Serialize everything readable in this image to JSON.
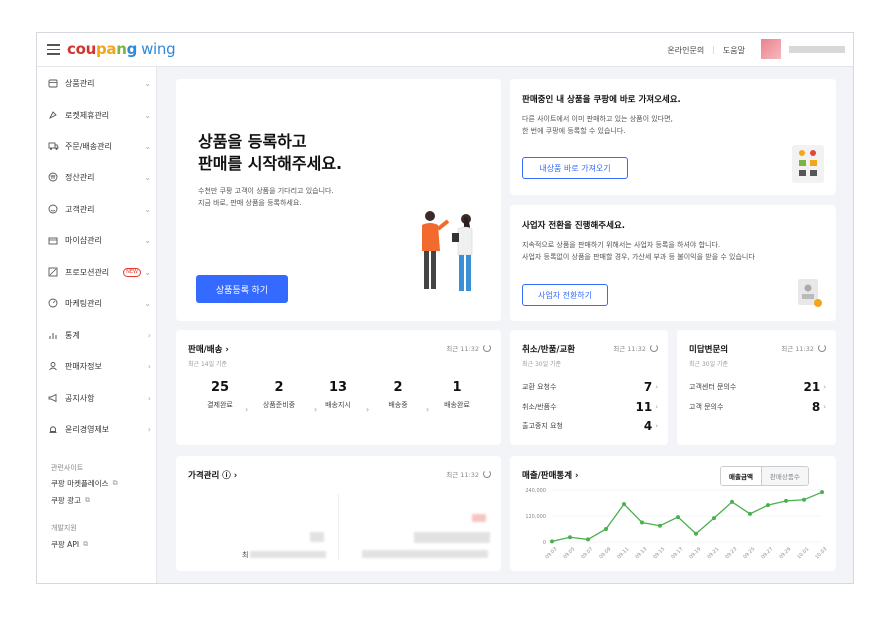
{
  "header": {
    "logo_parts": [
      "cou",
      "pa",
      "n",
      "g"
    ],
    "logo_wing": "wing",
    "links": [
      "온라인문의",
      "도움말"
    ]
  },
  "sidebar": {
    "items": [
      {
        "label": "상품관리",
        "icon": "box-icon"
      },
      {
        "label": "로켓제휴관리",
        "icon": "rocket-icon"
      },
      {
        "label": "주문/배송관리",
        "icon": "truck-icon"
      },
      {
        "label": "정산관리",
        "icon": "won-icon"
      },
      {
        "label": "고객관리",
        "icon": "smile-icon"
      },
      {
        "label": "마이샵관리",
        "icon": "shop-icon"
      },
      {
        "label": "프로모션관리",
        "icon": "promotion-icon",
        "badge": "NEW"
      },
      {
        "label": "마케팅관리",
        "icon": "marketing-icon"
      },
      {
        "label": "통계",
        "icon": "chart-icon"
      },
      {
        "label": "판매자정보",
        "icon": "user-icon"
      },
      {
        "label": "공지사항",
        "icon": "megaphone-icon"
      },
      {
        "label": "윤리경영제보",
        "icon": "bell-icon"
      }
    ],
    "related_title": "관련사이트",
    "related_links": [
      "쿠팡 마켓플레이스",
      "쿠팡 광고"
    ],
    "dev_title": "개발지원",
    "dev_links": [
      "쿠팡 API"
    ]
  },
  "hero": {
    "title_line1": "상품을 등록하고",
    "title_line2": "판매를 시작해주세요.",
    "sub_line1": "수천만 쿠팡 고객이 상품을 기다리고 있습니다.",
    "sub_line2": "지금 바로, 판매 상품을 등록하세요.",
    "button": "상품등록 하기"
  },
  "import_card": {
    "title": "판매중인 내 상품을 쿠팡에 바로 가져오세요.",
    "desc_line1": "다른 사이트에서 이미 판매하고 있는 상품이 있다면,",
    "desc_line2": "한 번에 쿠팡에 등록할 수 있습니다.",
    "button": "내상품 바로 가져오기"
  },
  "biz_card": {
    "title": "사업자 전환을 진행해주세요.",
    "desc_line1": "지속적으로 상품을 판매하기 위해서는 사업자 등록을 하셔야 합니다.",
    "desc_line2": "사업자 등록없이 상품을 판매할 경우, 가산세 부과 등 불이익을 받을 수 있습니다",
    "button": "사업자 전환하기"
  },
  "sales_card": {
    "title": "판매/배송",
    "recent": "최근 11:32",
    "note": "최근 14일 기준",
    "stats": [
      {
        "num": "25",
        "label": "결제완료"
      },
      {
        "num": "2",
        "label": "상품준비중"
      },
      {
        "num": "13",
        "label": "배송지시"
      },
      {
        "num": "2",
        "label": "배송중"
      },
      {
        "num": "1",
        "label": "배송완료"
      }
    ]
  },
  "returns_card": {
    "title": "취소/반품/교환",
    "recent": "최근 11:32",
    "note": "최근 30일 기준",
    "rows": [
      {
        "label": "교환 요청수",
        "value": "7"
      },
      {
        "label": "취소/반품수",
        "value": "11"
      },
      {
        "label": "출고중지 요청",
        "value": "4"
      }
    ]
  },
  "inquiry_card": {
    "title": "미답변문의",
    "recent": "최근 11:32",
    "note": "최근 30일 기준",
    "rows": [
      {
        "label": "고객센터 문의수",
        "value": "21"
      },
      {
        "label": "고객 문의수",
        "value": "8"
      }
    ]
  },
  "price_card": {
    "title": "가격관리",
    "recent": "최근 11:32",
    "prefix": "최"
  },
  "stats_card": {
    "title": "매출/판매통계",
    "tabs": [
      "매출금액",
      "판매상품수"
    ],
    "chart_data": {
      "type": "line",
      "yticks": [
        "240,000",
        "120,000",
        "0"
      ],
      "ylim": [
        0,
        240000
      ],
      "x": [
        "09.03",
        "09.05",
        "09.07",
        "09.09",
        "09.11",
        "09.13",
        "09.15",
        "09.17",
        "09.19",
        "09.21",
        "09.23",
        "09.25",
        "09.27",
        "09.29",
        "10.01",
        "10.03"
      ],
      "series": [
        {
          "color": "#4caf50",
          "values": [
            3000,
            22000,
            12000,
            60000,
            175000,
            90000,
            75000,
            115000,
            38000,
            110000,
            185000,
            130000,
            170000,
            190000,
            195000,
            230000
          ]
        }
      ]
    }
  },
  "colors": {
    "accent": "#346aff",
    "line": "#4caf50"
  }
}
